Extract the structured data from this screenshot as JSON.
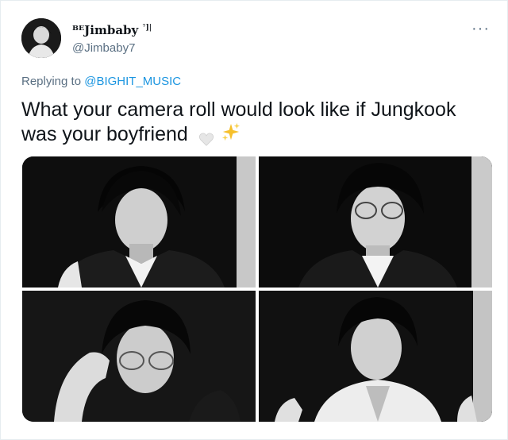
{
  "tweet": {
    "display_name": "ᴮᴱJimbaby",
    "name_suffix": "⁷]|",
    "handle": "@Jimbaby7",
    "more_label": "···",
    "replying_prefix": "Replying to ",
    "replying_to": "@BIGHIT_MUSIC",
    "text_line": "What your camera roll would look like if Jungkook was your boyfriend",
    "emoji": [
      "white-heart",
      "sparkles-icon"
    ]
  },
  "media": {
    "count": 4,
    "photos": [
      "photo-1",
      "photo-2",
      "photo-3",
      "photo-4"
    ]
  },
  "colors": {
    "link": "#1b95e0",
    "secondary_text": "#5b7083",
    "text": "#0f1419"
  }
}
